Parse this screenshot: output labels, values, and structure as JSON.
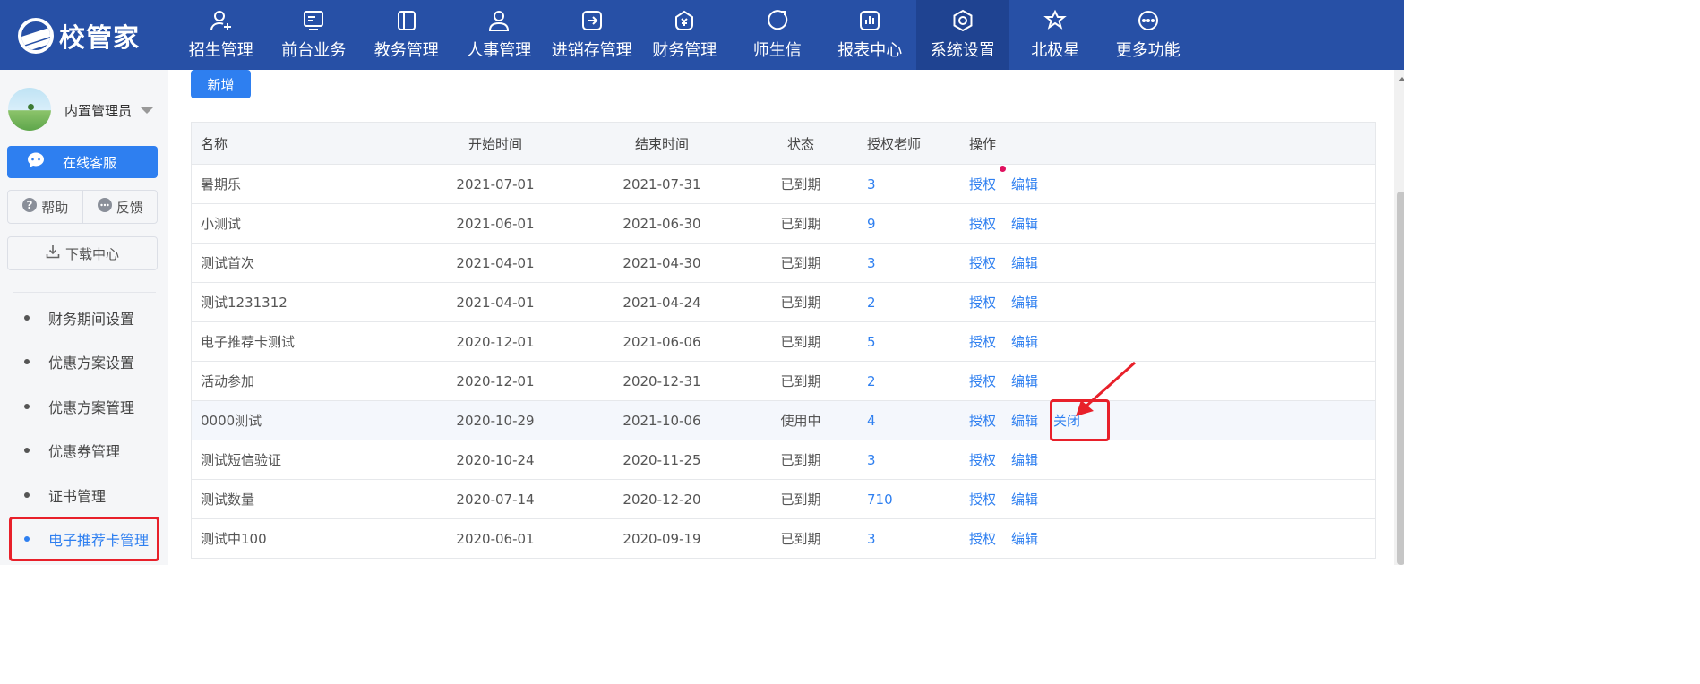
{
  "app": {
    "logo_text": "校管家"
  },
  "nav": [
    {
      "label": "招生管理",
      "icon": "person-add-icon",
      "active": false
    },
    {
      "label": "前台业务",
      "icon": "monitor-icon",
      "active": false
    },
    {
      "label": "教务管理",
      "icon": "book-icon",
      "active": false
    },
    {
      "label": "人事管理",
      "icon": "user-icon",
      "active": false
    },
    {
      "label": "进销存管理",
      "icon": "exchange-icon",
      "active": false
    },
    {
      "label": "财务管理",
      "icon": "money-bag-icon",
      "active": false
    },
    {
      "label": "师生信",
      "icon": "chat-icon",
      "active": false
    },
    {
      "label": "报表中心",
      "icon": "chart-icon",
      "active": false
    },
    {
      "label": "系统设置",
      "icon": "settings-icon",
      "active": true
    },
    {
      "label": "北极星",
      "icon": "star-icon",
      "active": false
    },
    {
      "label": "更多功能",
      "icon": "more-icon",
      "active": false
    }
  ],
  "sidebar": {
    "user_name": "内置管理员",
    "support_label": "在线客服",
    "help_label": "帮助",
    "feedback_label": "反馈",
    "download_label": "下载中心",
    "menu": [
      {
        "label": "财务期间设置",
        "active": false
      },
      {
        "label": "优惠方案设置",
        "active": false
      },
      {
        "label": "优惠方案管理",
        "active": false
      },
      {
        "label": "优惠券管理",
        "active": false
      },
      {
        "label": "证书管理",
        "active": false
      },
      {
        "label": "电子推荐卡管理",
        "active": true
      }
    ]
  },
  "main": {
    "new_button": "新增",
    "table": {
      "headers": {
        "name": "名称",
        "start": "开始时间",
        "end": "结束时间",
        "state": "状态",
        "teachers": "授权老师",
        "ops": "操作"
      },
      "op_labels": {
        "auth": "授权",
        "edit": "编辑",
        "close": "关闭"
      },
      "rows": [
        {
          "name": "暑期乐",
          "start": "2021-07-01",
          "end": "2021-07-31",
          "state": "已到期",
          "teachers": "3"
        },
        {
          "name": "小测试",
          "start": "2021-06-01",
          "end": "2021-06-30",
          "state": "已到期",
          "teachers": "9"
        },
        {
          "name": "测试首次",
          "start": "2021-04-01",
          "end": "2021-04-30",
          "state": "已到期",
          "teachers": "3"
        },
        {
          "name": "测试1231312",
          "start": "2021-04-01",
          "end": "2021-04-24",
          "state": "已到期",
          "teachers": "2"
        },
        {
          "name": "电子推荐卡测试",
          "start": "2020-12-01",
          "end": "2021-06-06",
          "state": "已到期",
          "teachers": "5"
        },
        {
          "name": "活动参加",
          "start": "2020-12-01",
          "end": "2020-12-31",
          "state": "已到期",
          "teachers": "2"
        },
        {
          "name": "0000测试",
          "start": "2020-10-29",
          "end": "2021-10-06",
          "state": "使用中",
          "teachers": "4"
        },
        {
          "name": "测试短信验证",
          "start": "2020-10-24",
          "end": "2020-11-25",
          "state": "已到期",
          "teachers": "3"
        },
        {
          "name": "测试数量",
          "start": "2020-07-14",
          "end": "2020-12-20",
          "state": "已到期",
          "teachers": "710"
        },
        {
          "name": "测试中100",
          "start": "2020-06-01",
          "end": "2020-09-19",
          "state": "已到期",
          "teachers": "3"
        }
      ]
    }
  },
  "colors": {
    "topbar": "#2750a6",
    "accent": "#2e7ff0",
    "annotation": "#e8202a",
    "dot": "#e0115f"
  }
}
